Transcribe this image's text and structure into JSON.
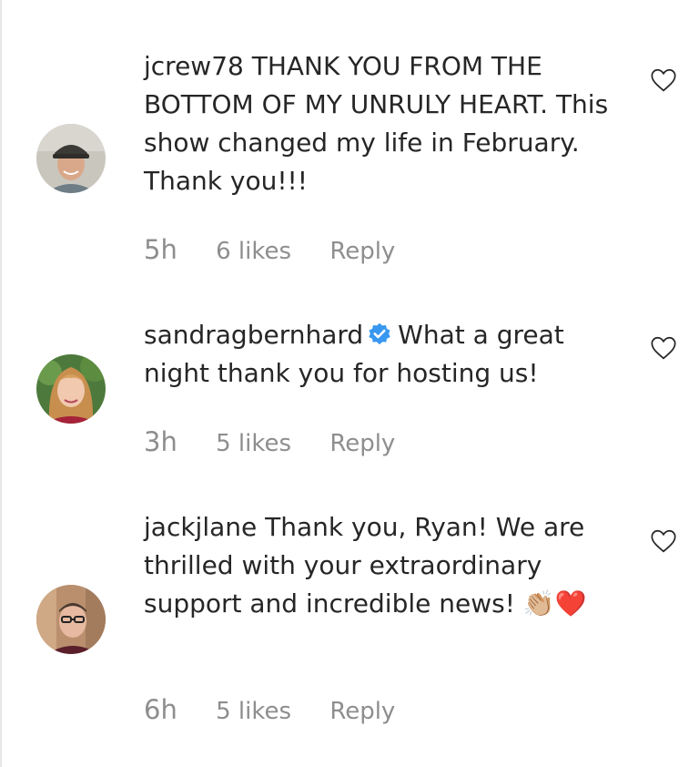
{
  "comments": [
    {
      "username": "jcrew78",
      "verified": false,
      "text": "THANK YOU FROM THE BOTTOM OF MY UNRULY HEART. This show changed my life in February. Thank you!!!",
      "time": "5h",
      "likes": "6 likes",
      "reply": "Reply",
      "avatar_icon": "person-photo"
    },
    {
      "username": "sandragbernhard",
      "verified": true,
      "text": "What a great night thank you for hosting us!",
      "time": "3h",
      "likes": "5 likes",
      "reply": "Reply",
      "avatar_icon": "person-photo"
    },
    {
      "username": "jackjlane",
      "verified": false,
      "text": "Thank you, Ryan! We are thrilled with your extraordinary support and incredible news!",
      "emoji": "👏🏼❤️",
      "time": "6h",
      "likes": "5 likes",
      "reply": "Reply",
      "avatar_icon": "person-photo"
    }
  ],
  "icons": {
    "like": "heart-outline-icon",
    "verified": "verified-badge-icon"
  },
  "colors": {
    "text": "#262626",
    "meta": "#8e8e8e",
    "verified": "#3897f0",
    "heart_outline": "#262626"
  }
}
